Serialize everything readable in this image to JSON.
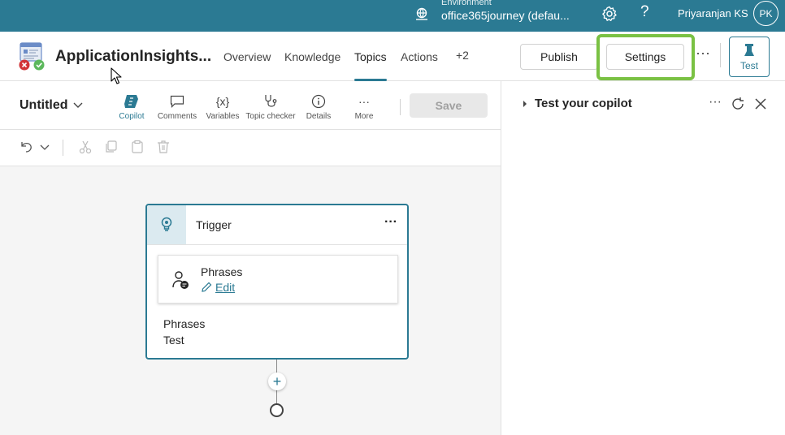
{
  "topbar": {
    "env_label": "Environment",
    "env_name": "office365journey (defau...",
    "user_name": "Priyaranjan KS",
    "avatar_initials": "PK",
    "bg_color": "#2b7a93"
  },
  "header": {
    "app_title": "ApplicationInsights...",
    "tabs": [
      {
        "label": "Overview"
      },
      {
        "label": "Knowledge"
      },
      {
        "label": "Topics",
        "active": true
      },
      {
        "label": "Actions"
      },
      {
        "label": "+2"
      }
    ],
    "publish_label": "Publish",
    "settings_label": "Settings",
    "test_label": "Test",
    "highlight_color": "#7ac143"
  },
  "toolbar": {
    "topic_name": "Untitled",
    "tools": [
      {
        "label": "Copilot",
        "icon": "copilot-icon",
        "active": true
      },
      {
        "label": "Comments",
        "icon": "comment-icon"
      },
      {
        "label": "Variables",
        "icon": "variables-icon",
        "glyph": "{x}"
      },
      {
        "label": "Topic checker",
        "icon": "stethoscope-icon"
      },
      {
        "label": "Details",
        "icon": "info-icon"
      },
      {
        "label": "More",
        "icon": "more-icon",
        "glyph": "···"
      }
    ],
    "save_label": "Save"
  },
  "canvas": {
    "node": {
      "title": "Trigger",
      "more": "···",
      "card_title": "Phrases",
      "card_action": "Edit",
      "phrases_label": "Phrases",
      "phrases_value": "Test"
    },
    "add_glyph": "+"
  },
  "test_panel": {
    "title": "Test your copilot",
    "more": "···"
  }
}
